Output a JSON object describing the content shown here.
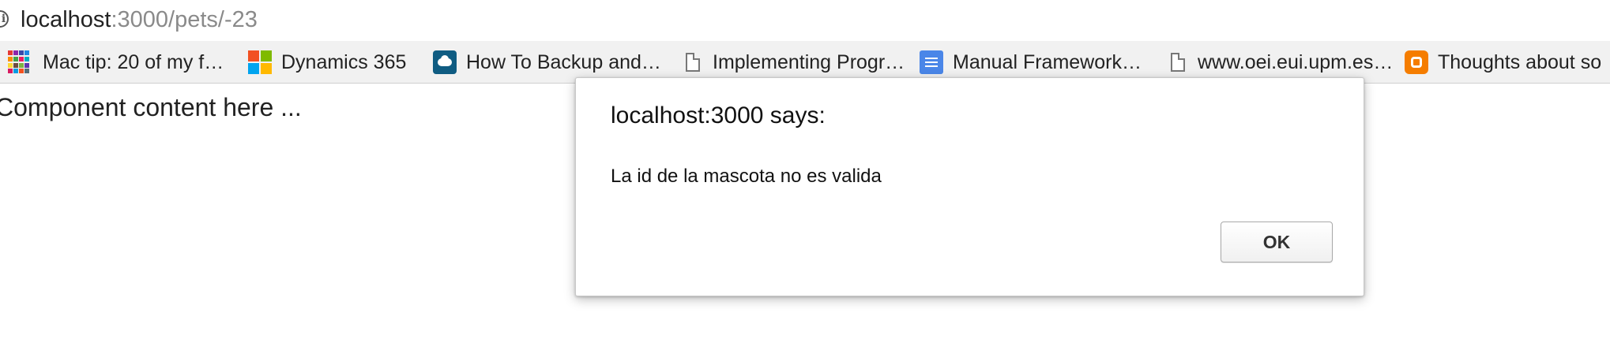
{
  "address_bar": {
    "host": "localhost",
    "path": ":3000/pets/-23"
  },
  "bookmarks": [
    {
      "label": "Mac tip: 20 of my f…",
      "icon": "colorful-grid-icon"
    },
    {
      "label": "Dynamics 365",
      "icon": "microsoft-logo-icon"
    },
    {
      "label": "How To Backup and…",
      "icon": "cloud-icon"
    },
    {
      "label": "Implementing Progr…",
      "icon": "page-icon"
    },
    {
      "label": "Manual Framework…",
      "icon": "google-docs-icon"
    },
    {
      "label": "www.oei.eui.upm.es…",
      "icon": "page-icon"
    },
    {
      "label": "Thoughts about so",
      "icon": "blogger-icon"
    }
  ],
  "page": {
    "content_text": "Component content here ..."
  },
  "dialog": {
    "title": "localhost:3000 says:",
    "message": "La id de la mascota no es valida",
    "ok_label": "OK"
  },
  "colors": {
    "bookmarks_bar": "#f1f1f1",
    "docs_blue": "#4a86e8",
    "blogger_orange": "#f57d00",
    "cloud_blue": "#0f5c82"
  }
}
